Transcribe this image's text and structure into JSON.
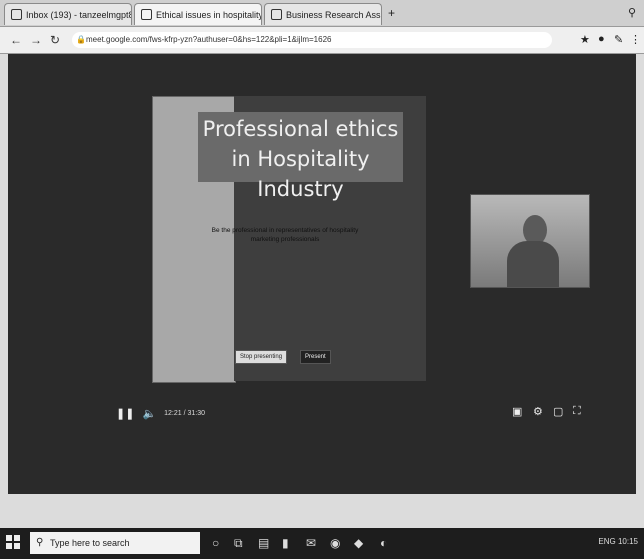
{
  "browser": {
    "tabs": [
      {
        "label": "Inbox (193) - tanzeelmgpt8@",
        "active": false
      },
      {
        "label": "Ethical issues in hospitality",
        "active": true
      },
      {
        "label": "Business Research Assign",
        "active": false
      }
    ],
    "new_tab_icon": "plus-icon",
    "url": "meet.google.com/fws-kfrp-yzn?authuser=0&hs=122&pli=1&ijlm=1626"
  },
  "presentation": {
    "title_line1": "Professional ethics",
    "title_line2": "in Hospitality Industry",
    "subtitle_line1": "Be the professional in representatives of hospitality",
    "subtitle_line2": "marketing professionals",
    "stop_label": "Stop presenting",
    "present_label": "Present"
  },
  "player": {
    "time": "12:21 / 31:30"
  },
  "taskbar": {
    "search_placeholder": "Type here to search",
    "tray_text": "ENG 10:15"
  }
}
